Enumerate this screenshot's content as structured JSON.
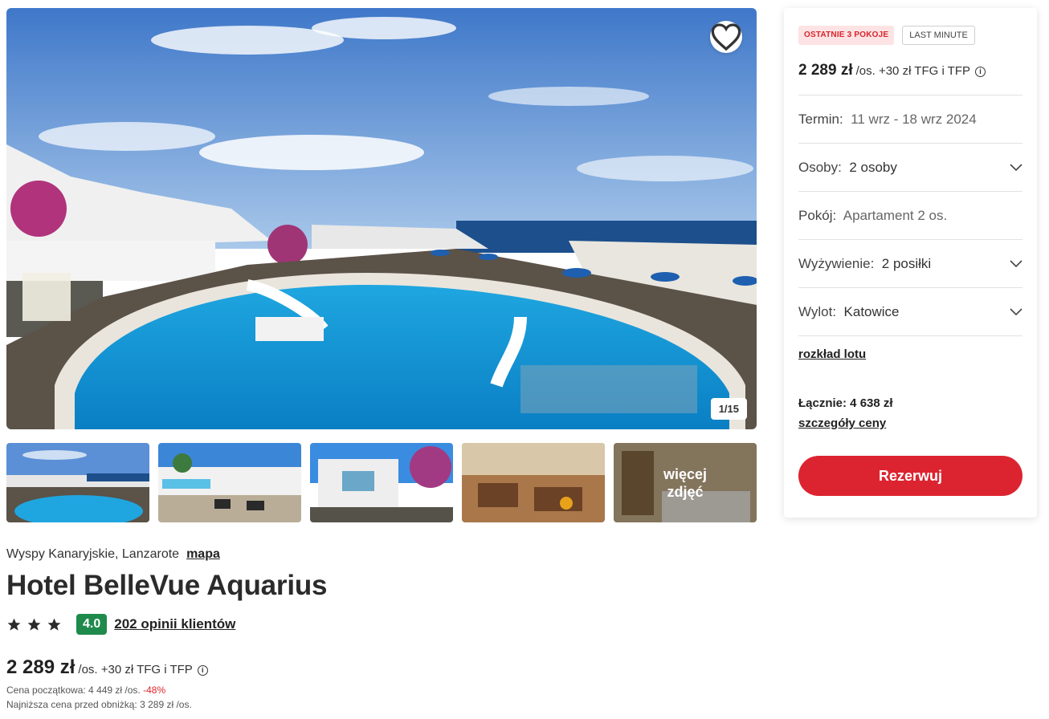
{
  "gallery": {
    "counter": "1/15",
    "more_label": "więcej zdjęć",
    "favorite_icon": "heart-icon"
  },
  "hotel": {
    "location": "Wyspy Kanaryjskie, Lanzarote",
    "map_link": "mapa",
    "name": "Hotel BelleVue Aquarius",
    "stars": 3,
    "score": "4.0",
    "reviews": "202 opinii klientów"
  },
  "price": {
    "amount": "2 289 zł",
    "suffix": "/os. +30 zł TFG i TFP",
    "initial": "Cena początkowa: 4 449 zł /os.",
    "discount": "-48%",
    "lowest": "Najniższa cena przed obniżką: 3 289 zł /os."
  },
  "booking": {
    "badge_last_rooms": "OSTATNIE 3 POKOJE",
    "badge_last_minute": "LAST MINUTE",
    "price_amount": "2 289 zł",
    "price_suffix": "/os. +30 zł TFG i TFP",
    "term_label": "Termin:",
    "term_value": "11 wrz - 18 wrz 2024",
    "persons_label": "Osoby:",
    "persons_value": "2 osoby",
    "room_label": "Pokój:",
    "room_value": "Apartament 2 os.",
    "board_label": "Wyżywienie:",
    "board_value": "2 posiłki",
    "departure_label": "Wylot:",
    "departure_value": "Katowice",
    "flight_schedule": "rozkład lotu",
    "total": "Łącznie: 4 638 zł",
    "price_details": "szczegóły ceny",
    "reserve": "Rezerwuj"
  },
  "colors": {
    "accent": "#dc2430",
    "score_bg": "#1e8a4c",
    "badge_red": "#d9262d"
  }
}
